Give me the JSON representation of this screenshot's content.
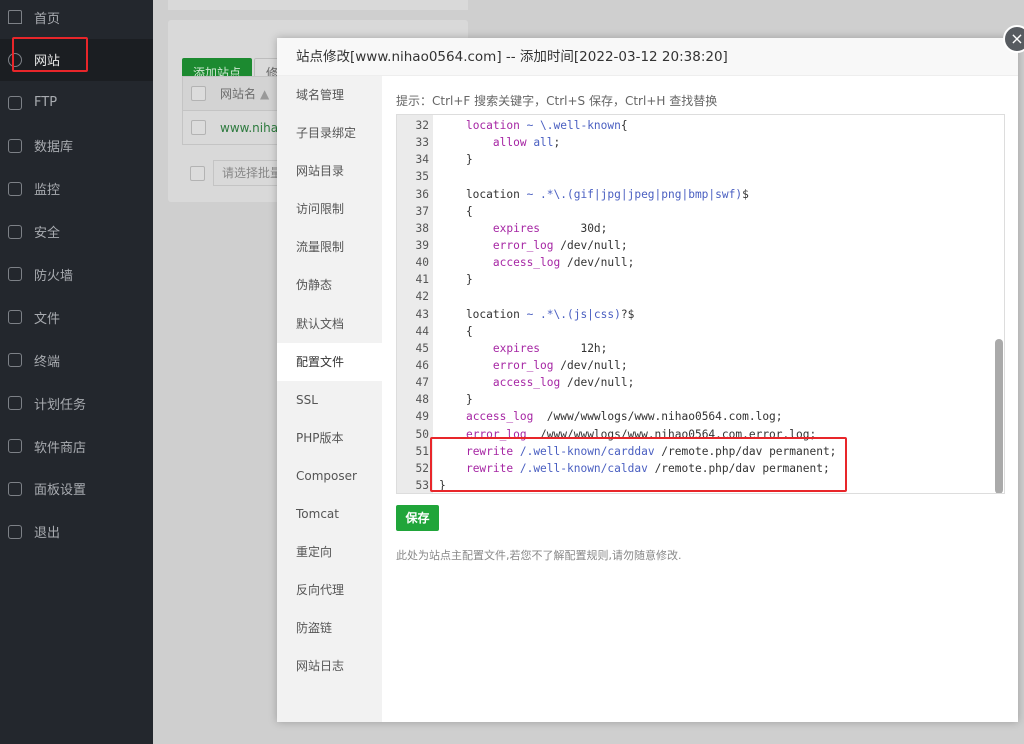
{
  "sidebar": {
    "items": [
      {
        "label": "首页",
        "icon": "home-icon"
      },
      {
        "label": "网站",
        "icon": "globe-icon",
        "active": true
      },
      {
        "label": "FTP",
        "icon": "ftp-icon"
      },
      {
        "label": "数据库",
        "icon": "database-icon"
      },
      {
        "label": "监控",
        "icon": "monitor-icon"
      },
      {
        "label": "安全",
        "icon": "shield-icon"
      },
      {
        "label": "防火墙",
        "icon": "firewall-icon"
      },
      {
        "label": "文件",
        "icon": "folder-icon"
      },
      {
        "label": "终端",
        "icon": "terminal-icon"
      },
      {
        "label": "计划任务",
        "icon": "calendar-icon"
      },
      {
        "label": "软件商店",
        "icon": "apps-icon"
      },
      {
        "label": "面板设置",
        "icon": "gear-icon"
      },
      {
        "label": "退出",
        "icon": "logout-icon"
      }
    ]
  },
  "background": {
    "add_site": "添加站点",
    "modify": "修",
    "col_name": "网站名",
    "site": "www.nihao",
    "batch_placeholder": "请选择批量"
  },
  "modal": {
    "title": "站点修改[www.nihao0564.com] -- 添加时间[2022-03-12 20:38:20]",
    "close": "×",
    "nav": [
      "域名管理",
      "子目录绑定",
      "网站目录",
      "访问限制",
      "流量限制",
      "伪静态",
      "默认文档",
      "配置文件",
      "SSL",
      "PHP版本",
      "Composer",
      "Tomcat",
      "重定向",
      "反向代理",
      "防盗链",
      "网站日志"
    ],
    "active_nav": "配置文件",
    "tip": "提示：Ctrl+F 搜索关键字，Ctrl+S 保存，Ctrl+H 查找替换",
    "code": [
      {
        "n": "32",
        "t": [
          [
            "",
            "    "
          ],
          [
            "kw",
            "location"
          ],
          [
            "st",
            " ~ \\.well-known"
          ],
          [
            "",
            "{"
          ]
        ]
      },
      {
        "n": "33",
        "t": [
          [
            "",
            "        "
          ],
          [
            "kw",
            "allow"
          ],
          [
            "st",
            " all"
          ],
          [
            "",
            ";"
          ]
        ]
      },
      {
        "n": "34",
        "t": [
          [
            "",
            "    }"
          ]
        ]
      },
      {
        "n": "35",
        "t": []
      },
      {
        "n": "36",
        "t": [
          [
            "",
            "    location"
          ],
          [
            "st",
            " ~ .*\\.(gif|jpg|jpeg|png|bmp|swf)"
          ],
          [
            "",
            "$"
          ]
        ]
      },
      {
        "n": "37",
        "t": [
          [
            "",
            "    {"
          ]
        ]
      },
      {
        "n": "38",
        "t": [
          [
            "",
            "        "
          ],
          [
            "kw",
            "expires"
          ],
          [
            "",
            "      30d;"
          ]
        ]
      },
      {
        "n": "39",
        "t": [
          [
            "",
            "        "
          ],
          [
            "kw",
            "error_log"
          ],
          [
            "",
            " /dev/null;"
          ]
        ]
      },
      {
        "n": "40",
        "t": [
          [
            "",
            "        "
          ],
          [
            "kw",
            "access_log"
          ],
          [
            "",
            " /dev/null;"
          ]
        ]
      },
      {
        "n": "41",
        "t": [
          [
            "",
            "    }"
          ]
        ]
      },
      {
        "n": "42",
        "t": []
      },
      {
        "n": "43",
        "t": [
          [
            "",
            "    location"
          ],
          [
            "st",
            " ~ .*\\.(js|css)"
          ],
          [
            "",
            "?$"
          ]
        ]
      },
      {
        "n": "44",
        "t": [
          [
            "",
            "    {"
          ]
        ]
      },
      {
        "n": "45",
        "t": [
          [
            "",
            "        "
          ],
          [
            "kw",
            "expires"
          ],
          [
            "",
            "      12h;"
          ]
        ]
      },
      {
        "n": "46",
        "t": [
          [
            "",
            "        "
          ],
          [
            "kw",
            "error_log"
          ],
          [
            "",
            " /dev/null;"
          ]
        ]
      },
      {
        "n": "47",
        "t": [
          [
            "",
            "        "
          ],
          [
            "kw",
            "access_log"
          ],
          [
            "",
            " /dev/null;"
          ]
        ]
      },
      {
        "n": "48",
        "t": [
          [
            "",
            "    }"
          ]
        ]
      },
      {
        "n": "49",
        "t": [
          [
            "",
            "    "
          ],
          [
            "kw",
            "access_log"
          ],
          [
            "",
            "  /www/wwwlogs/www.nihao0564.com.log;"
          ]
        ]
      },
      {
        "n": "50",
        "t": [
          [
            "",
            "    "
          ],
          [
            "kw",
            "error_log"
          ],
          [
            "",
            "  /www/wwwlogs/www.nihao0564.com.error.log;"
          ]
        ]
      },
      {
        "n": "51",
        "t": [
          [
            "",
            "    "
          ],
          [
            "kw",
            "rewrite"
          ],
          [
            "st",
            " /.well-known/carddav"
          ],
          [
            "",
            " /remote.php/dav permanent;"
          ]
        ]
      },
      {
        "n": "52",
        "t": [
          [
            "",
            "    "
          ],
          [
            "kw",
            "rewrite"
          ],
          [
            "st",
            " /.well-known/caldav"
          ],
          [
            "",
            " /remote.php/dav permanent;"
          ]
        ]
      },
      {
        "n": "53",
        "t": [
          [
            "",
            "}"
          ]
        ]
      }
    ],
    "save": "保存",
    "note": "此处为站点主配置文件,若您不了解配置规则,请勿随意修改."
  },
  "colors": {
    "accent": "#20a53a",
    "highlight": "#e8262a",
    "sidebar": "#23272d"
  }
}
